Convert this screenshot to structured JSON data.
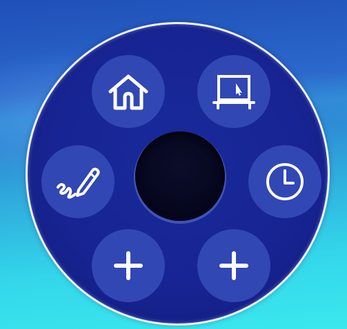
{
  "launcher": {
    "title": "",
    "items": [
      {
        "name": "home",
        "icon": "home-icon"
      },
      {
        "name": "screen",
        "icon": "screen-cursor-icon"
      },
      {
        "name": "annotate",
        "icon": "pen-signature-icon"
      },
      {
        "name": "clock",
        "icon": "clock-icon"
      },
      {
        "name": "add-left",
        "icon": "plus-icon"
      },
      {
        "name": "add-right",
        "icon": "plus-icon"
      }
    ],
    "colors": {
      "ring_fill": "#172493",
      "slot_fill": "#3147b4",
      "ring_border": "#eef2ff",
      "icon": "#ffffff",
      "hub": "#05061c"
    }
  }
}
